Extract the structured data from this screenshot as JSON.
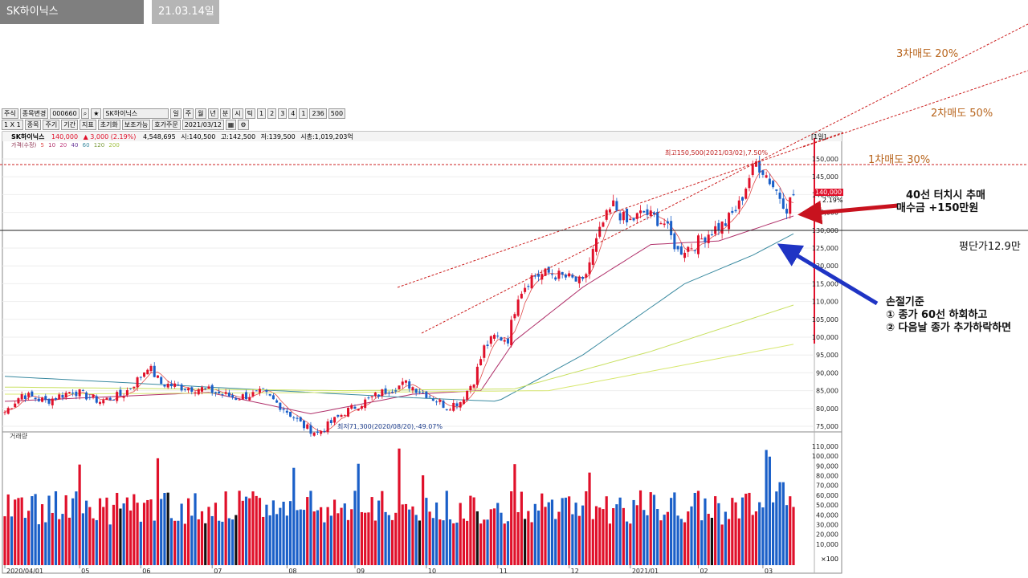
{
  "header": {
    "stock_tab": "SK하이닉스",
    "date_tab": "21.03.14일"
  },
  "toolbar": {
    "row1": [
      "주식",
      "종목변경",
      "000660",
      "SK하이닉스",
      "일",
      "주",
      "월",
      "년",
      "분",
      "시",
      "틱",
      "1",
      "2",
      "3",
      "4",
      "1",
      "236",
      "500"
    ],
    "row2": [
      "1 X 1",
      "종목",
      "주기",
      "기간",
      "지표",
      "초기화",
      "보조가능",
      "호가주문",
      "2021/03/12"
    ]
  },
  "price_bar": {
    "name": "SK하이닉스",
    "price": "140,000",
    "change": "▲ 3,000 (2.19%)",
    "volume": "4,548,695",
    "open": "시:140,500",
    "high": "고:142,500",
    "low": "저:139,500",
    "mcap": "시총:1,019,203억"
  },
  "legend": {
    "title": "가격(수정)",
    "ma": [
      "5",
      "10",
      "20",
      "40",
      "60",
      "120",
      "200"
    ]
  },
  "period_label": "[1일]",
  "high_note": "최고150,500(2021/03/02),7.50%",
  "low_note": "최저71,300(2020/08/20),-49.07%",
  "current_price_box": "140,000",
  "current_pct": "2.19%",
  "volume_label": "거래량",
  "volume_unit": "×100",
  "annotations": {
    "sell3": "3차매도 20%",
    "sell2": "2차매도 50%",
    "sell1": "1차매도 30%",
    "buy_line1": "40선 터치시 추매",
    "buy_line2": "매수금 +150만원",
    "avg": "평단가12.9만",
    "stop_title": "손절기준",
    "stop1": "① 종가 60선 하회하고",
    "stop2": "② 다음날 종가 추가하락하면"
  },
  "colors": {
    "up": "#e0102a",
    "down": "#1a5fc8",
    "ma5": "#e04a4a",
    "ma20": "#b0306a",
    "ma60": "#3a8aa0",
    "ma120": "#c8e060",
    "trend": "#cc2020",
    "arrow_red": "#c8121e",
    "arrow_blue": "#1f34c4"
  },
  "chart_data": {
    "type": "candlestick",
    "x_ticks": [
      "2020/04/01",
      "05",
      "06",
      "07",
      "08",
      "09",
      "10",
      "11",
      "12",
      "2021/01",
      "02",
      "03"
    ],
    "y_ticks": [
      75000,
      80000,
      85000,
      90000,
      95000,
      100000,
      105000,
      110000,
      115000,
      120000,
      125000,
      130000,
      135000,
      140000,
      145000,
      150000
    ],
    "ylim": [
      71000,
      155000
    ],
    "volume_ticks": [
      10000,
      20000,
      30000,
      40000,
      50000,
      60000,
      70000,
      80000,
      90000,
      100000,
      110000
    ],
    "close_path": [
      [
        0,
        79000
      ],
      [
        5,
        84000
      ],
      [
        12,
        82000
      ],
      [
        20,
        85000
      ],
      [
        28,
        82000
      ],
      [
        35,
        84000
      ],
      [
        40,
        89000
      ],
      [
        42,
        92000
      ],
      [
        46,
        87000
      ],
      [
        52,
        86000
      ],
      [
        58,
        85500
      ],
      [
        62,
        84500
      ],
      [
        68,
        83000
      ],
      [
        76,
        84500
      ],
      [
        82,
        80000
      ],
      [
        88,
        75000
      ],
      [
        92,
        73000
      ],
      [
        96,
        76000
      ],
      [
        100,
        79000
      ],
      [
        106,
        82000
      ],
      [
        112,
        85000
      ],
      [
        118,
        87000
      ],
      [
        124,
        84000
      ],
      [
        130,
        80500
      ],
      [
        134,
        82000
      ],
      [
        138,
        88000
      ],
      [
        141,
        97000
      ],
      [
        144,
        100000
      ],
      [
        148,
        99500
      ],
      [
        151,
        112000
      ],
      [
        155,
        117000
      ],
      [
        160,
        118000
      ],
      [
        166,
        116500
      ],
      [
        170,
        115000
      ],
      [
        173,
        124000
      ],
      [
        176,
        132000
      ],
      [
        179,
        137000
      ],
      [
        183,
        132000
      ],
      [
        188,
        135000
      ],
      [
        194,
        132000
      ],
      [
        198,
        124000
      ],
      [
        203,
        126000
      ],
      [
        208,
        130000
      ],
      [
        212,
        132000
      ],
      [
        216,
        137000
      ],
      [
        219,
        145000
      ],
      [
        221,
        149000
      ],
      [
        223,
        147000
      ],
      [
        227,
        141000
      ],
      [
        230,
        136500
      ],
      [
        232,
        140000
      ]
    ],
    "moving_averages": {
      "ma20": [
        [
          0,
          82000
        ],
        [
          60,
          84500
        ],
        [
          90,
          78500
        ],
        [
          120,
          84000
        ],
        [
          140,
          85000
        ],
        [
          150,
          99000
        ],
        [
          170,
          114000
        ],
        [
          190,
          126000
        ],
        [
          210,
          127000
        ],
        [
          232,
          134000
        ]
      ],
      "ma60": [
        [
          0,
          89000
        ],
        [
          60,
          86000
        ],
        [
          120,
          83000
        ],
        [
          145,
          82000
        ],
        [
          170,
          95000
        ],
        [
          200,
          115000
        ],
        [
          220,
          123000
        ],
        [
          232,
          129000
        ]
      ],
      "ma120": [
        [
          0,
          86000
        ],
        [
          100,
          85000
        ],
        [
          150,
          85500
        ],
        [
          190,
          96000
        ],
        [
          232,
          109000
        ]
      ],
      "ma200": [
        [
          0,
          84000
        ],
        [
          100,
          84500
        ],
        [
          160,
          85000
        ],
        [
          232,
          98000
        ]
      ]
    },
    "annotated_high": {
      "value": 150500,
      "date": "2021/03/02"
    },
    "annotated_low": {
      "value": 71300,
      "date": "2020/08/20"
    }
  }
}
